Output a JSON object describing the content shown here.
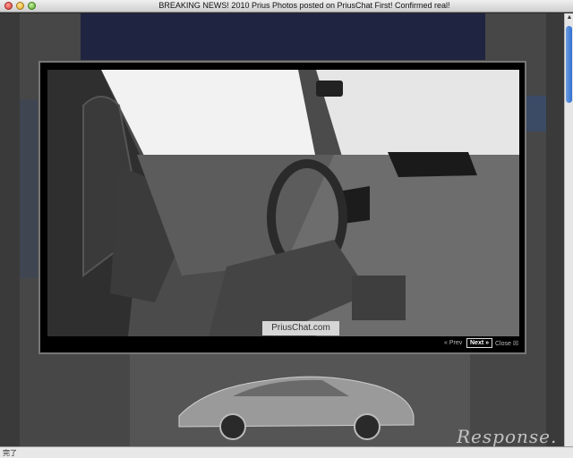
{
  "window": {
    "title": "BREAKING NEWS! 2010 Prius Photos posted on PriusChat First! Confirmed real!"
  },
  "status_bar": {
    "text": "完了"
  },
  "lightbox": {
    "caption": "PriusChat.com",
    "counter": "",
    "prev_label": "« Prev",
    "next_label": "Next »",
    "close_label": "Close ☒"
  },
  "background": {
    "watermark": "Response."
  },
  "colors": {
    "scroll_thumb": "#2f6fd0",
    "banner": "#1f2440"
  },
  "icons": [
    "close-window-icon",
    "minimize-window-icon",
    "zoom-window-icon",
    "scroll-up-arrow-icon"
  ]
}
